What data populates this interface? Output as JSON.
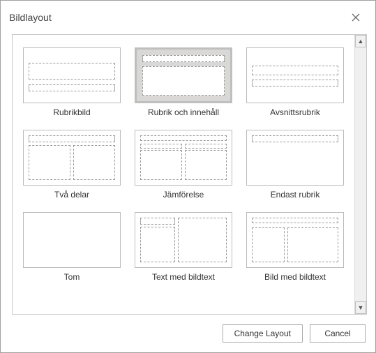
{
  "dialog": {
    "title": "Bildlayout",
    "change_btn": "Change Layout",
    "cancel_btn": "Cancel"
  },
  "layouts": [
    {
      "id": "rubrikbild",
      "label": "Rubrikbild",
      "selected": false,
      "type": "titleslide"
    },
    {
      "id": "rubrik-innehall",
      "label": "Rubrik och innehåll",
      "selected": true,
      "type": "content"
    },
    {
      "id": "avsnittsrubrik",
      "label": "Avsnittsrubrik",
      "selected": false,
      "type": "section"
    },
    {
      "id": "tva-delar",
      "label": "Två delar",
      "selected": false,
      "type": "two"
    },
    {
      "id": "jamforelse",
      "label": "Jämförelse",
      "selected": false,
      "type": "comp"
    },
    {
      "id": "endast-rubrik",
      "label": "Endast rubrik",
      "selected": false,
      "type": "only"
    },
    {
      "id": "tom",
      "label": "Tom",
      "selected": false,
      "type": "blank"
    },
    {
      "id": "text-bildtext",
      "label": "Text med bildtext",
      "selected": false,
      "type": "cap"
    },
    {
      "id": "bild-bildtext",
      "label": "Bild med bildtext",
      "selected": false,
      "type": "pcap"
    }
  ]
}
